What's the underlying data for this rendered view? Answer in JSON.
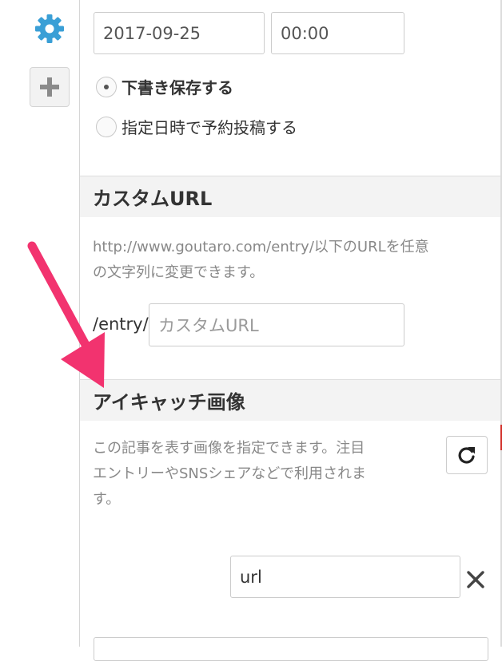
{
  "rail": {
    "settings_icon": "gear-icon",
    "add_icon": "plus-icon",
    "accent_color": "#3a9fd6"
  },
  "schedule": {
    "date_value": "2017-09-25",
    "time_value": "00:00",
    "options": [
      {
        "label": "下書き保存する",
        "selected": true
      },
      {
        "label": "指定日時で予約投稿する",
        "selected": false
      }
    ]
  },
  "custom_url": {
    "heading": "カスタムURL",
    "description_line1": "http://www.goutaro.com/entry/以下のURLを任意",
    "description_line2": "の文字列に変更できます。",
    "prefix": "/entry/",
    "placeholder": "カスタムURL"
  },
  "eyecatch": {
    "heading": "アイキャッチ画像",
    "description_line1": "この記事を表す画像を指定できます。注目",
    "description_line2": "エントリーやSNSシェアなどで利用されま",
    "description_line3": "す。",
    "refresh_icon": "refresh-icon",
    "url_value": "url",
    "clear_icon": "close-icon"
  },
  "annotation": {
    "arrow_color": "#f2336f"
  }
}
